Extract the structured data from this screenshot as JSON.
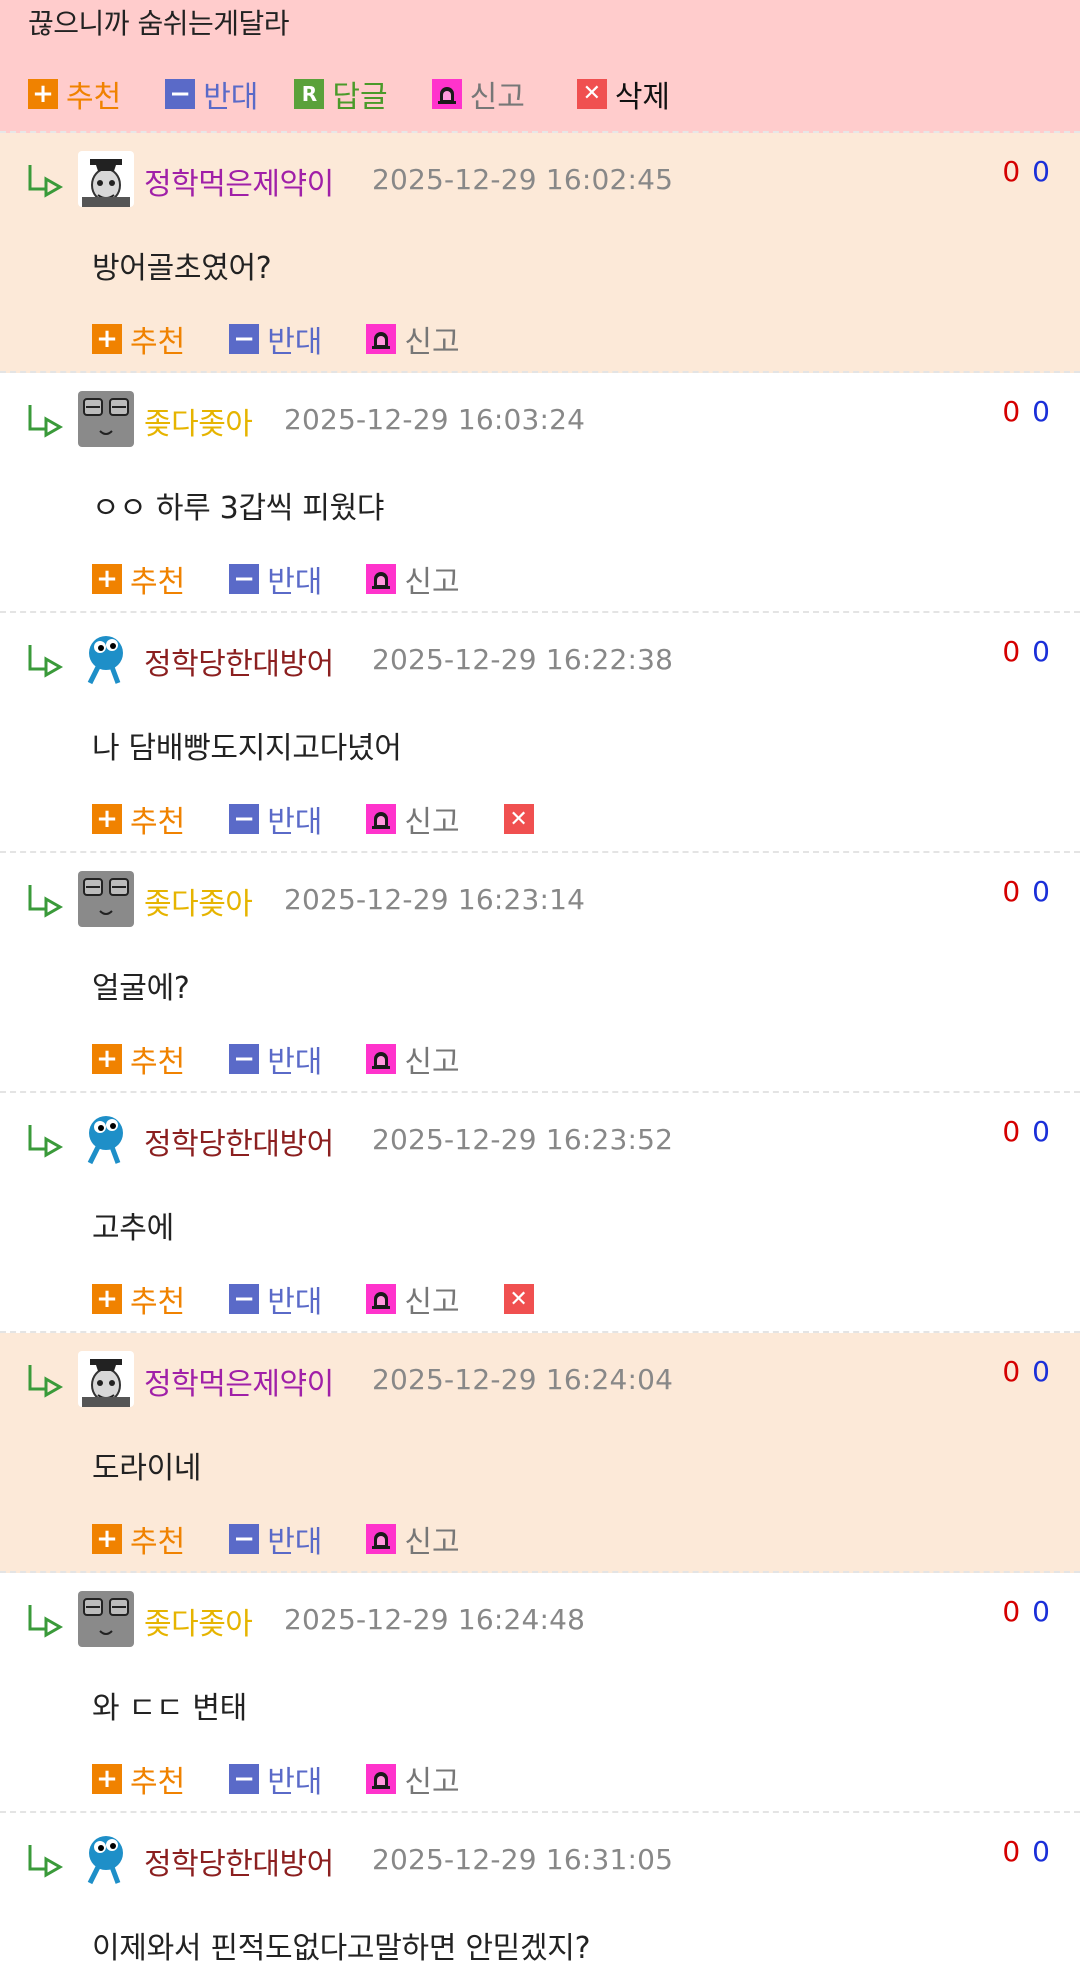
{
  "top": {
    "text": "끊으니까 숨쉬는게달라",
    "actions": {
      "recommend": "추천",
      "oppose": "반대",
      "reply": "답글",
      "report": "신고",
      "delete": "삭제"
    }
  },
  "labels": {
    "recommend": "추천",
    "oppose": "반대",
    "report": "신고"
  },
  "comments": [
    {
      "author": "정학먹은제약이",
      "date": "2025-12-29 16:02:45",
      "body": "방어골초였어?",
      "up": "0",
      "down": "0"
    },
    {
      "author": "좆다좆아",
      "date": "2025-12-29 16:03:24",
      "body": "ㅇㅇ 하루 3갑씩 피웠댜",
      "up": "0",
      "down": "0"
    },
    {
      "author": "정학당한대방어",
      "date": "2025-12-29 16:22:38",
      "body": "나 담배빵도지지고다녔어",
      "up": "0",
      "down": "0"
    },
    {
      "author": "좆다좆아",
      "date": "2025-12-29 16:23:14",
      "body": "얼굴에?",
      "up": "0",
      "down": "0"
    },
    {
      "author": "정학당한대방어",
      "date": "2025-12-29 16:23:52",
      "body": "고추에",
      "up": "0",
      "down": "0"
    },
    {
      "author": "정학먹은제약이",
      "date": "2025-12-29 16:24:04",
      "body": "도라이네",
      "up": "0",
      "down": "0"
    },
    {
      "author": "좆다좆아",
      "date": "2025-12-29 16:24:48",
      "body": "와 ㄷㄷ 변태",
      "up": "0",
      "down": "0"
    },
    {
      "author": "정학당한대방어",
      "date": "2025-12-29 16:31:05",
      "body": "이제와서 핀적도없다고말하면 안믿겠지?",
      "up": "0",
      "down": "0"
    }
  ],
  "colors": {
    "top_bg": "#ffcccc",
    "highlight_bg": "#fce9d8",
    "recommend": "#f08200",
    "oppose": "#5a6ac8",
    "reply": "#4a9a2a",
    "report_icon": "#ff33cc",
    "delete_icon": "#f05050",
    "vote_up": "#d40000",
    "vote_down": "#1a2fd8"
  }
}
